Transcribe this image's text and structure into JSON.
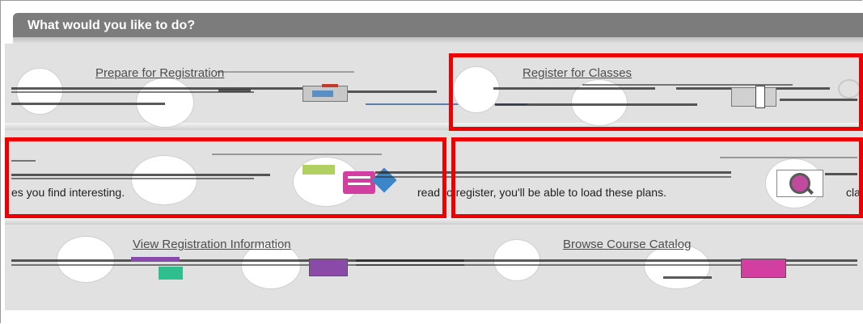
{
  "header": {
    "title": "What would you like to do?"
  },
  "cards": {
    "prepare": {
      "title": "Prepare for Registration"
    },
    "register": {
      "title": "Register for Classes"
    },
    "plan_ahead": {
      "desc": "es you find interesting."
    },
    "plans": {
      "desc_a": "read",
      "desc_b": "o register, you'll be able to load these plans."
    },
    "plans_right": {
      "desc": "cla"
    },
    "view_info": {
      "title": "View Registration Information"
    },
    "browse": {
      "title": "Browse Course Catalog"
    }
  },
  "colors": {
    "header_bg": "#7c7c7c",
    "panel_bg": "#e1e1e1",
    "highlight": "#ef0000",
    "accent_pink": "#d23fa0",
    "accent_blue": "#3a86c8"
  },
  "icons": {
    "calendar": "calendar-icon",
    "magnifier": "magnifier-icon",
    "plan": "plan-icon"
  }
}
